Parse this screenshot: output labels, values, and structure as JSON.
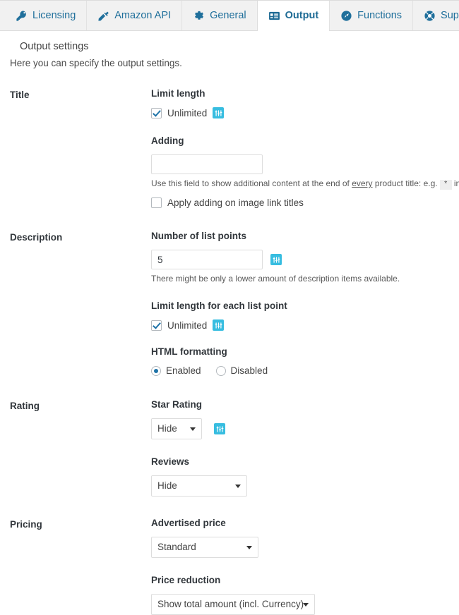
{
  "tabs": [
    {
      "label": "Licensing",
      "icon": "key-icon",
      "active": false
    },
    {
      "label": "Amazon API",
      "icon": "plug-icon",
      "active": false
    },
    {
      "label": "General",
      "icon": "gear-icon",
      "active": false
    },
    {
      "label": "Output",
      "icon": "list-card-icon",
      "active": true
    },
    {
      "label": "Functions",
      "icon": "dashboard-icon",
      "active": false
    },
    {
      "label": "Support",
      "icon": "life-ring-icon",
      "active": false
    }
  ],
  "page": {
    "title": "Output settings",
    "subtitle": "Here you can specify the output settings."
  },
  "sections": {
    "title": {
      "label": "Title",
      "limit_length_label": "Limit length",
      "unlimited_label": "Unlimited",
      "unlimited_checked": true,
      "adding_label": "Adding",
      "adding_value": "",
      "adding_placeholder": "",
      "help_prefix": "Use this field to show additional content at the end of ",
      "help_underlined": "every",
      "help_middle": " product title: e.g. ",
      "help_code": "*",
      "help_suffix": " in or",
      "apply_adding_label": "Apply adding on image link titles",
      "apply_adding_checked": false
    },
    "description": {
      "label": "Description",
      "list_points_label": "Number of list points",
      "list_points_value": "5",
      "list_points_help": "There might be only a lower amount of description items available.",
      "limit_each_label": "Limit length for each list point",
      "unlimited_label": "Unlimited",
      "unlimited_checked": true,
      "html_formatting_label": "HTML formatting",
      "radio_enabled_label": "Enabled",
      "radio_disabled_label": "Disabled",
      "html_formatting_value": "Enabled"
    },
    "rating": {
      "label": "Rating",
      "star_rating_label": "Star Rating",
      "star_rating_value": "Hide",
      "reviews_label": "Reviews",
      "reviews_value": "Hide"
    },
    "pricing": {
      "label": "Pricing",
      "advertised_price_label": "Advertised price",
      "advertised_price_value": "Standard",
      "price_reduction_label": "Price reduction",
      "price_reduction_value": "Show total amount (incl. Currency)"
    }
  },
  "colors": {
    "tab_text": "#1f6f9b",
    "badge_bg": "#37bde0",
    "accent": "#1e73a8",
    "tabbar_bg": "#f1f1f1"
  }
}
